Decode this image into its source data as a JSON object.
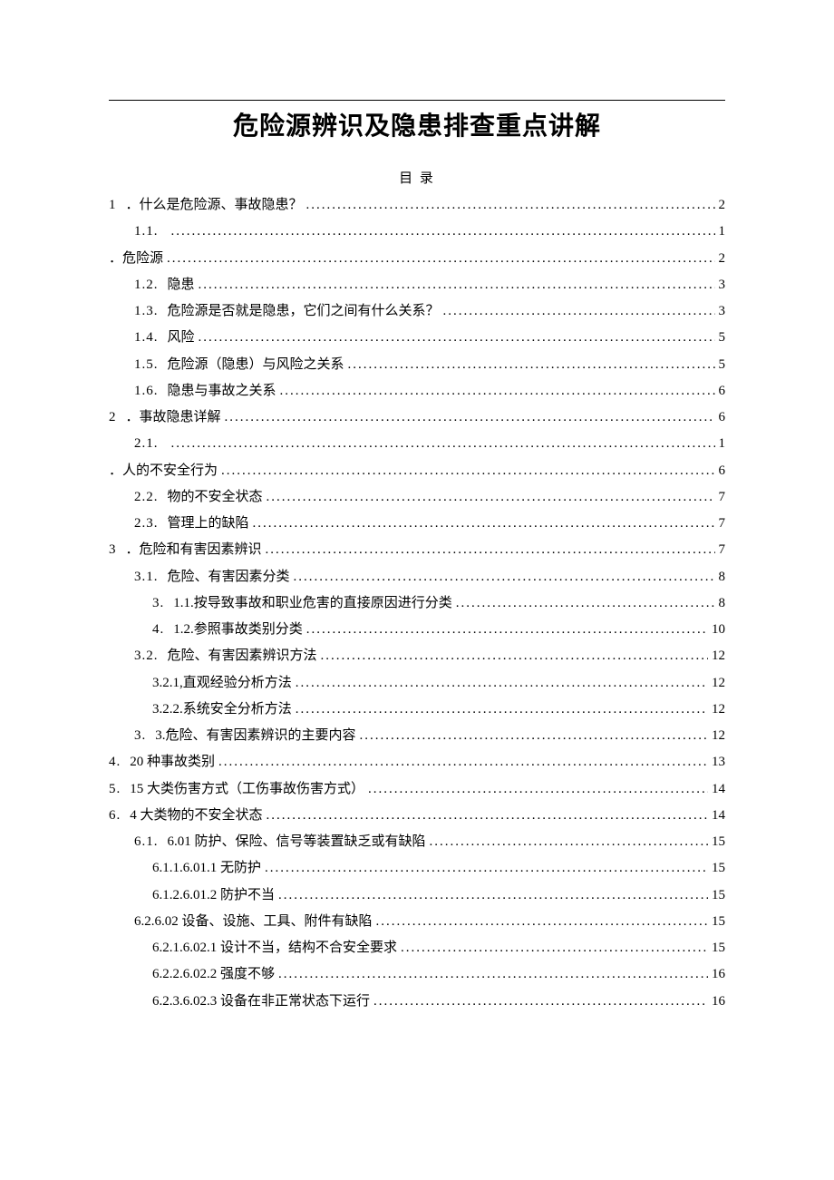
{
  "title": "危险源辨识及隐患排查重点讲解",
  "toc_label": "目 录",
  "entries": [
    {
      "type": "row",
      "lvl": 0,
      "num": "1",
      "txt": "．什么是危险源、事故隐患？",
      "pg": "2"
    },
    {
      "type": "wrap",
      "lvl": 1,
      "num": "1.1.",
      "txt": "",
      "trail_pg": "1",
      "cont_label": "．危险源",
      "cont_pg": "2"
    },
    {
      "type": "row",
      "lvl": 1,
      "num": "1.2.",
      "txt": "隐患",
      "pg": "3"
    },
    {
      "type": "row",
      "lvl": 1,
      "num": "1.3.",
      "txt": "危险源是否就是隐患，它们之间有什么关系？",
      "pg": "3"
    },
    {
      "type": "row",
      "lvl": 1,
      "num": "1.4.",
      "txt": "风险",
      "pg": "5"
    },
    {
      "type": "row",
      "lvl": 1,
      "num": "1.5.",
      "txt": "危险源（隐患）与风险之关系",
      "pg": "5"
    },
    {
      "type": "row",
      "lvl": 1,
      "num": "1.6.",
      "txt": "隐患与事故之关系",
      "pg": "6"
    },
    {
      "type": "row",
      "lvl": 0,
      "num": "2",
      "txt": "．事故隐患详解",
      "pg": "6"
    },
    {
      "type": "wrap",
      "lvl": 1,
      "num": "2.1.",
      "txt": "",
      "trail_pg": "1",
      "cont_label": "．人的不安全行为",
      "cont_pg": "6"
    },
    {
      "type": "row",
      "lvl": 1,
      "num": "2.2.",
      "txt": "物的不安全状态",
      "pg": "7"
    },
    {
      "type": "row",
      "lvl": 1,
      "num": "2.3.",
      "txt": "管理上的缺陷",
      "pg": "7"
    },
    {
      "type": "row",
      "lvl": 0,
      "num": "3",
      "txt": "．危险和有害因素辨识",
      "pg": "7"
    },
    {
      "type": "row",
      "lvl": 1,
      "num": "3.1.",
      "txt": "危险、有害因素分类",
      "pg": "8"
    },
    {
      "type": "row",
      "lvl": 2,
      "num": "3.",
      "txt": "1.1.按导致事故和职业危害的直接原因进行分类",
      "pg": "8"
    },
    {
      "type": "row",
      "lvl": 2,
      "num": "4.",
      "txt": "1.2.参照事故类别分类",
      "pg": "10"
    },
    {
      "type": "row",
      "lvl": 1,
      "num": "3.2.",
      "txt": "危险、有害因素辨识方法",
      "pg": "12"
    },
    {
      "type": "row",
      "lvl": 2,
      "num": "",
      "txt": "3.2.1,直观经验分析方法",
      "pg": "12"
    },
    {
      "type": "row",
      "lvl": 2,
      "num": "",
      "txt": "3.2.2.系统安全分析方法",
      "pg": "12"
    },
    {
      "type": "row",
      "lvl": 1,
      "num": "3.",
      "txt": "3.危险、有害因素辨识的主要内容",
      "pg": "12"
    },
    {
      "type": "row",
      "lvl": 0,
      "num": "4.",
      "txt": "20 种事故类别",
      "pg": "13"
    },
    {
      "type": "row",
      "lvl": 0,
      "num": "5.",
      "txt": "15 大类伤害方式（工伤事故伤害方式）",
      "pg": "14"
    },
    {
      "type": "row",
      "lvl": 0,
      "num": "6.",
      "txt": "4 大类物的不安全状态",
      "pg": "14"
    },
    {
      "type": "row",
      "lvl": 1,
      "num": "6.1.",
      "txt": "6.01 防护、保险、信号等装置缺乏或有缺陷",
      "pg": "15"
    },
    {
      "type": "row",
      "lvl": 2,
      "num": "",
      "txt": "6.1.1.6.01.1 无防护",
      "pg": "15"
    },
    {
      "type": "row",
      "lvl": 2,
      "num": "",
      "txt": "6.1.2.6.01.2 防护不当",
      "pg": "15"
    },
    {
      "type": "row",
      "lvl": 1,
      "num": "",
      "txt": "6.2.6.02 设备、设施、工具、附件有缺陷",
      "pg": "15"
    },
    {
      "type": "row",
      "lvl": 2,
      "num": "",
      "txt": "6.2.1.6.02.1 设计不当，结构不合安全要求",
      "pg": "15"
    },
    {
      "type": "row",
      "lvl": 2,
      "num": "",
      "txt": "6.2.2.6.02.2 强度不够",
      "pg": "16"
    },
    {
      "type": "row",
      "lvl": 2,
      "num": "",
      "txt": "6.2.3.6.02.3 设备在非正常状态下运行",
      "pg": "16"
    }
  ]
}
